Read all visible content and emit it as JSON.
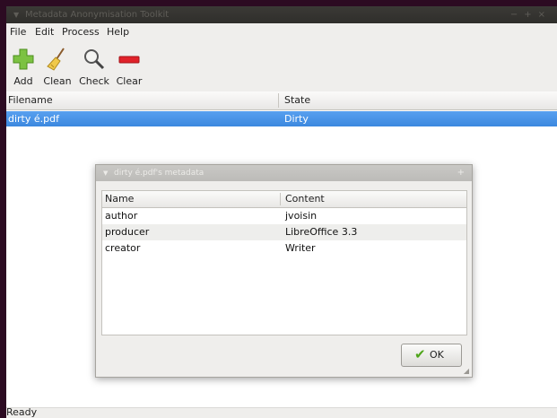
{
  "window": {
    "title": "Metadata Anonymisation Toolkit",
    "controls": [
      "−",
      "+",
      "×"
    ]
  },
  "menu": [
    "File",
    "Edit",
    "Process",
    "Help"
  ],
  "toolbar": {
    "add": "Add",
    "clean": "Clean",
    "check": "Check",
    "clear": "Clear"
  },
  "file_list": {
    "columns": [
      "Filename",
      "State"
    ],
    "rows": [
      {
        "filename": "dirty é.pdf",
        "state": "Dirty",
        "selected": true
      }
    ]
  },
  "status": "Ready",
  "dialog": {
    "title": "dirty é.pdf's metadata",
    "columns": [
      "Name",
      "Content"
    ],
    "rows": [
      {
        "name": "author",
        "content": "jvoisin"
      },
      {
        "name": "producer",
        "content": "LibreOffice 3.3"
      },
      {
        "name": "creator",
        "content": "Writer"
      }
    ],
    "ok": "OK"
  },
  "colors": {
    "selection": "#3c88df",
    "desktop": "#2c0b22"
  },
  "icons": {
    "add": "plus-icon",
    "clean": "broom-icon",
    "check": "magnifier-icon",
    "clear": "minus-icon",
    "ok": "checkmark-icon"
  }
}
